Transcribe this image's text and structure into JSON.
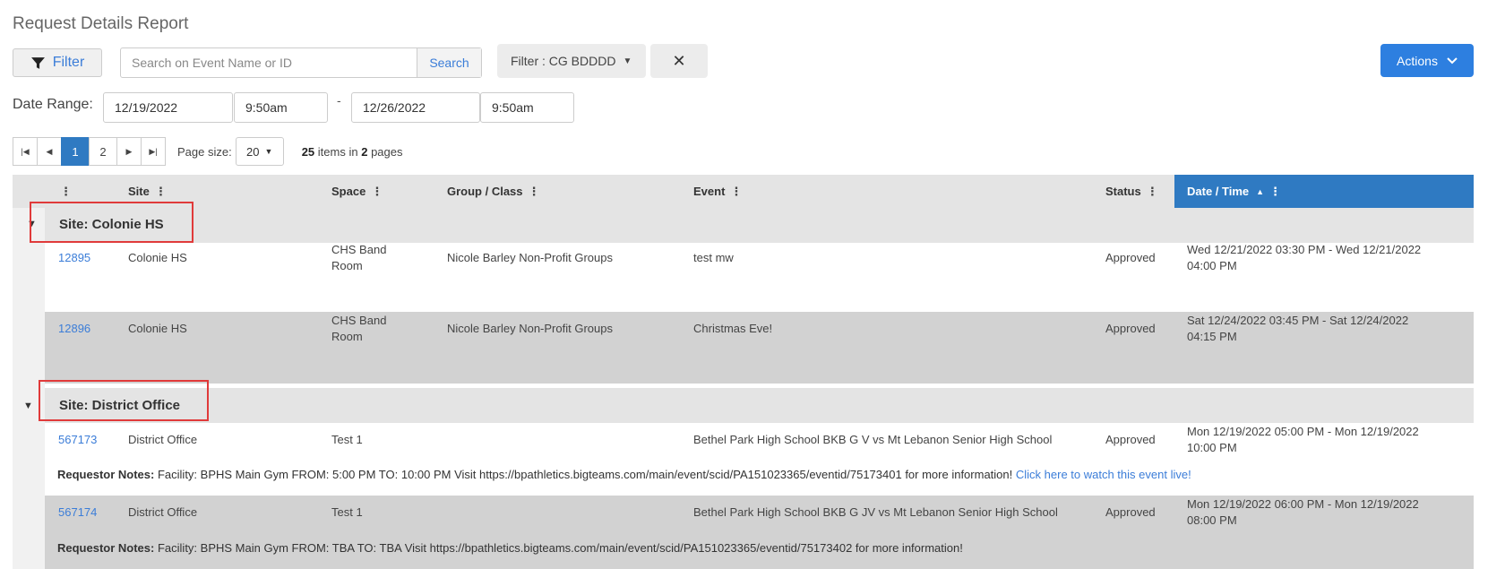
{
  "page": {
    "title": "Request Details Report"
  },
  "toolbar": {
    "filter_label": "Filter",
    "search_placeholder": "Search on Event Name or ID",
    "search_button": "Search",
    "filter_chip": "Filter : CG BDDDD",
    "clear_symbol": "✕",
    "actions_label": "Actions"
  },
  "date_range": {
    "label": "Date Range:",
    "start_date": "12/19/2022",
    "start_time": "9:50am",
    "dash": "-",
    "end_date": "12/26/2022",
    "end_time": "9:50am"
  },
  "pager": {
    "pages": [
      "1",
      "2"
    ],
    "current_page": "1",
    "page_size_label": "Page size:",
    "page_size": "20",
    "total_items": "25",
    "items_text": "items in",
    "total_pages": "2",
    "pages_text": "pages"
  },
  "grid": {
    "columns": {
      "site": "Site",
      "space": "Space",
      "group": "Group / Class",
      "event": "Event",
      "status": "Status",
      "datetime": "Date / Time"
    },
    "groups": [
      {
        "label": "Site: Colonie HS",
        "rows": [
          {
            "id": "12895",
            "site": "Colonie HS",
            "space_line1": "CHS Band",
            "space_line2": "Room",
            "group": "Nicole Barley Non-Profit Groups",
            "event": "test mw",
            "status": "Approved",
            "datetime_line1": "Wed 12/21/2022 03:30 PM - Wed 12/21/2022",
            "datetime_line2": "04:00 PM"
          },
          {
            "id": "12896",
            "site": "Colonie HS",
            "space_line1": "CHS Band",
            "space_line2": "Room",
            "group": "Nicole Barley Non-Profit Groups",
            "event": "Christmas Eve!",
            "status": "Approved",
            "datetime_line1": "Sat 12/24/2022 03:45 PM - Sat 12/24/2022",
            "datetime_line2": "04:15 PM"
          }
        ]
      },
      {
        "label": "Site: District Office",
        "rows": [
          {
            "id": "567173",
            "site": "District Office",
            "space_line1": "Test 1",
            "group": "",
            "event": "Bethel Park High School BKB G V vs Mt Lebanon Senior High School",
            "status": "Approved",
            "datetime_line1": "Mon 12/19/2022 05:00 PM - Mon 12/19/2022",
            "datetime_line2": "10:00 PM",
            "notes_label": "Requestor Notes:",
            "notes_text": "Facility: BPHS Main Gym FROM: 5:00 PM TO: 10:00 PM Visit https://bpathletics.bigteams.com/main/event/scid/PA151023365/eventid/75173401 for more information!",
            "notes_link": "Click here to watch this event live!"
          },
          {
            "id": "567174",
            "site": "District Office",
            "space_line1": "Test 1",
            "group": "",
            "event": "Bethel Park High School BKB G JV vs Mt Lebanon Senior High School",
            "status": "Approved",
            "datetime_line1": "Mon 12/19/2022 06:00 PM - Mon 12/19/2022",
            "datetime_line2": "08:00 PM",
            "notes_label": "Requestor Notes:",
            "notes_text": "Facility: BPHS Main Gym FROM: TBA TO: TBA Visit https://bpathletics.bigteams.com/main/event/scid/PA151023365/eventid/75173402 for more information!"
          }
        ]
      }
    ]
  },
  "colors": {
    "accent": "#2d7fe0",
    "sorted_header": "#2f7ac2",
    "highlight_box": "#e03a3a"
  },
  "icons": {
    "filter": "funnel-icon",
    "caret": "caret-down-icon",
    "chevron": "chevron-down-icon",
    "sort": "sort-asc-icon",
    "kebab": "kebab-icon"
  }
}
